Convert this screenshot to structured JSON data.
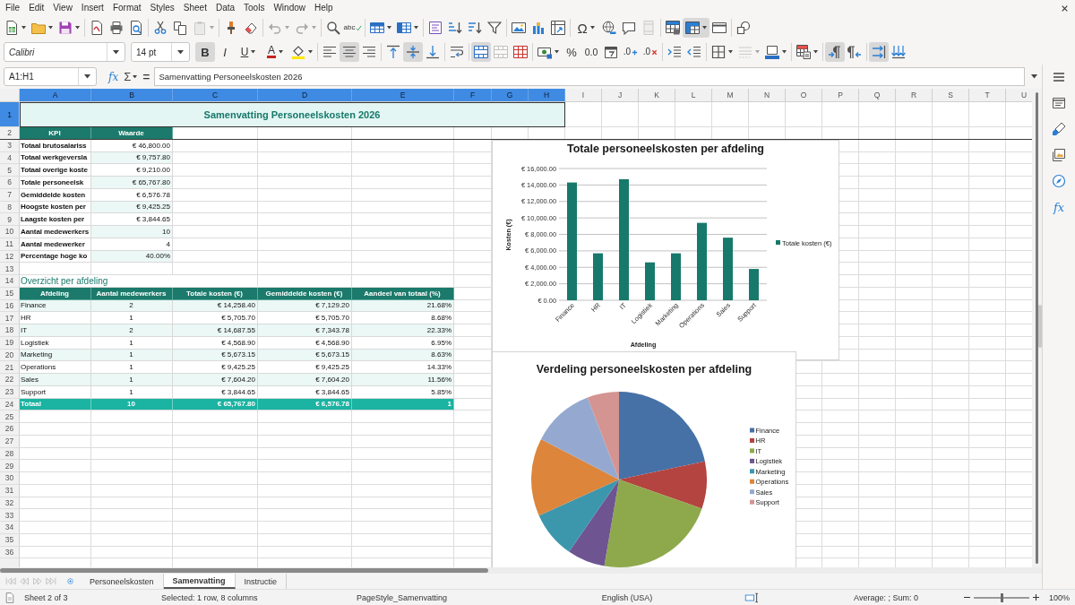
{
  "menu_bar": {
    "items": [
      "File",
      "Edit",
      "View",
      "Insert",
      "Format",
      "Styles",
      "Sheet",
      "Data",
      "Tools",
      "Window",
      "Help"
    ]
  },
  "standard_toolbar": {
    "groups": [
      [
        {
          "kind": "new",
          "on": false,
          "disabled": false,
          "dropdown": true
        },
        {
          "kind": "open",
          "on": false,
          "disabled": false,
          "dropdown": true
        },
        {
          "kind": "save",
          "on": false,
          "disabled": false,
          "dropdown": true
        }
      ],
      [
        {
          "kind": "pdf",
          "on": false,
          "disabled": false,
          "dropdown": false
        },
        {
          "kind": "print",
          "on": false,
          "disabled": false,
          "dropdown": false
        },
        {
          "kind": "preview",
          "on": false,
          "disabled": false,
          "dropdown": false
        }
      ],
      [
        {
          "kind": "cut",
          "on": false,
          "disabled": false,
          "dropdown": false
        },
        {
          "kind": "copy",
          "on": false,
          "disabled": false,
          "dropdown": false
        },
        {
          "kind": "paste",
          "on": false,
          "disabled": true,
          "dropdown": true
        }
      ],
      [
        {
          "kind": "clone",
          "on": false,
          "disabled": false,
          "dropdown": false
        },
        {
          "kind": "clear",
          "on": false,
          "disabled": false,
          "dropdown": false
        }
      ],
      [
        {
          "kind": "undo",
          "on": false,
          "disabled": true,
          "dropdown": true
        },
        {
          "kind": "redo",
          "on": false,
          "disabled": true,
          "dropdown": true
        }
      ],
      [
        {
          "kind": "find",
          "on": false,
          "disabled": false,
          "dropdown": false
        },
        {
          "kind": "spell",
          "label": "abc",
          "on": false,
          "disabled": false,
          "dropdown": false
        }
      ],
      [
        {
          "kind": "row",
          "on": false,
          "disabled": false,
          "dropdown": true
        },
        {
          "kind": "column",
          "on": false,
          "disabled": false,
          "dropdown": true
        }
      ],
      [
        {
          "kind": "sort",
          "on": false,
          "disabled": false,
          "dropdown": false
        },
        {
          "kind": "asc",
          "on": false,
          "disabled": false,
          "dropdown": false
        },
        {
          "kind": "desc",
          "on": false,
          "disabled": false,
          "dropdown": false
        },
        {
          "kind": "filter",
          "on": false,
          "disabled": false,
          "dropdown": false
        }
      ],
      [
        {
          "kind": "image",
          "on": false,
          "disabled": false,
          "dropdown": false
        },
        {
          "kind": "chart",
          "on": false,
          "disabled": false,
          "dropdown": false
        },
        {
          "kind": "pivot",
          "on": false,
          "disabled": false,
          "dropdown": false
        }
      ],
      [
        {
          "kind": "special",
          "label": "Ω",
          "on": false,
          "disabled": false,
          "dropdown": true
        },
        {
          "kind": "link",
          "on": false,
          "disabled": false,
          "dropdown": false
        },
        {
          "kind": "comment",
          "on": false,
          "disabled": false,
          "dropdown": false
        },
        {
          "kind": "headfoot",
          "on": false,
          "disabled": true,
          "dropdown": false
        }
      ],
      [
        {
          "kind": "printarea",
          "on": false,
          "disabled": false,
          "dropdown": false
        },
        {
          "kind": "freeze",
          "on": true,
          "disabled": false,
          "dropdown": true
        },
        {
          "kind": "split",
          "on": false,
          "disabled": false,
          "dropdown": false
        }
      ],
      [
        {
          "kind": "draw",
          "on": false,
          "disabled": false,
          "dropdown": false
        }
      ]
    ]
  },
  "formatting_toolbar": {
    "font_name": "Calibri",
    "font_size": "14 pt",
    "groups": [
      [
        {
          "kind": "bold",
          "label": "B",
          "on": true,
          "disabled": false,
          "dropdown": false
        },
        {
          "kind": "italic",
          "label": "I",
          "on": false,
          "disabled": false,
          "dropdown": false
        },
        {
          "kind": "underline",
          "label": "U",
          "on": false,
          "disabled": false,
          "dropdown": true
        },
        {
          "kind": "fontcolor",
          "label": "A",
          "on": false,
          "disabled": false,
          "dropdown": true
        },
        {
          "kind": "highlight",
          "on": false,
          "disabled": false,
          "dropdown": true
        }
      ],
      [
        {
          "kind": "alignleft",
          "on": false,
          "disabled": false,
          "dropdown": false
        },
        {
          "kind": "aligncenter",
          "on": true,
          "disabled": false,
          "dropdown": false
        },
        {
          "kind": "alignright",
          "on": false,
          "disabled": false,
          "dropdown": false
        }
      ],
      [
        {
          "kind": "top",
          "on": false,
          "disabled": false,
          "dropdown": false
        },
        {
          "kind": "middle",
          "on": true,
          "disabled": false,
          "dropdown": false
        },
        {
          "kind": "bottom",
          "on": false,
          "disabled": false,
          "dropdown": false
        }
      ],
      [
        {
          "kind": "wrap",
          "on": false,
          "disabled": false,
          "dropdown": false
        }
      ],
      [
        {
          "kind": "mergecenter",
          "on": true,
          "disabled": false,
          "dropdown": false
        },
        {
          "kind": "merge",
          "on": false,
          "disabled": true,
          "dropdown": false
        },
        {
          "kind": "unmerge",
          "on": false,
          "disabled": false,
          "dropdown": false
        }
      ],
      [
        {
          "kind": "currency",
          "on": false,
          "disabled": false,
          "dropdown": true
        },
        {
          "kind": "percent",
          "label": "%",
          "on": false,
          "disabled": false,
          "dropdown": false
        },
        {
          "kind": "number",
          "label": "0.0",
          "on": false,
          "disabled": false,
          "dropdown": false
        },
        {
          "kind": "date",
          "on": false,
          "disabled": false,
          "dropdown": false
        },
        {
          "kind": "adddec",
          "label": ".0",
          "on": false,
          "disabled": false,
          "dropdown": false
        },
        {
          "kind": "deldec",
          "label": ".0",
          "on": false,
          "disabled": false,
          "dropdown": false
        }
      ],
      [
        {
          "kind": "indent",
          "on": false,
          "disabled": false,
          "dropdown": false
        },
        {
          "kind": "outdent",
          "on": false,
          "disabled": false,
          "dropdown": false
        }
      ],
      [
        {
          "kind": "borders",
          "on": false,
          "disabled": false,
          "dropdown": true
        },
        {
          "kind": "borderstyle",
          "on": false,
          "disabled": true,
          "dropdown": true
        },
        {
          "kind": "bordercolor",
          "on": false,
          "disabled": false,
          "dropdown": true
        }
      ],
      [
        {
          "kind": "conditional",
          "on": false,
          "disabled": false,
          "dropdown": true
        }
      ],
      [
        {
          "kind": "ltr",
          "on": true,
          "disabled": false,
          "dropdown": false
        },
        {
          "kind": "rtl",
          "on": false,
          "disabled": false,
          "dropdown": false
        }
      ],
      [
        {
          "kind": "texth",
          "on": true,
          "disabled": false,
          "dropdown": false
        },
        {
          "kind": "textv",
          "on": false,
          "disabled": false,
          "dropdown": false
        }
      ]
    ]
  },
  "formula_bar": {
    "name_box": "A1:H1",
    "function_wizard": "fx",
    "sum": "Σ",
    "equals": "=",
    "content": "Samenvatting Personeelskosten 2026"
  },
  "sidebar": {
    "buttons": [
      {
        "kind": "menu"
      },
      {
        "kind": "properties"
      },
      {
        "kind": "styles"
      },
      {
        "kind": "gallery"
      },
      {
        "kind": "navigator"
      },
      {
        "kind": "functions",
        "label": "fx"
      }
    ]
  },
  "sheet": {
    "columns": [
      {
        "label": "A",
        "selected": true
      },
      {
        "label": "B",
        "selected": true
      },
      {
        "label": "C",
        "selected": true
      },
      {
        "label": "D",
        "selected": true
      },
      {
        "label": "E",
        "selected": true
      },
      {
        "label": "F",
        "selected": true
      },
      {
        "label": "G",
        "selected": true
      },
      {
        "label": "H",
        "selected": true
      },
      {
        "label": "I",
        "selected": false
      },
      {
        "label": "J",
        "selected": false
      },
      {
        "label": "K",
        "selected": false
      },
      {
        "label": "L",
        "selected": false
      },
      {
        "label": "M",
        "selected": false
      },
      {
        "label": "N",
        "selected": false
      },
      {
        "label": "O",
        "selected": false
      },
      {
        "label": "P",
        "selected": false
      },
      {
        "label": "Q",
        "selected": false
      },
      {
        "label": "R",
        "selected": false
      },
      {
        "label": "S",
        "selected": false
      },
      {
        "label": "T",
        "selected": false
      },
      {
        "label": "U",
        "selected": false
      }
    ],
    "row_numbers": [
      {
        "label": "1",
        "selected": true
      },
      {
        "label": "2",
        "selected": false
      },
      {
        "label": "3",
        "selected": false
      },
      {
        "label": "4",
        "selected": false
      },
      {
        "label": "5",
        "selected": false
      },
      {
        "label": "6",
        "selected": false
      },
      {
        "label": "7",
        "selected": false
      },
      {
        "label": "8",
        "selected": false
      },
      {
        "label": "9",
        "selected": false
      },
      {
        "label": "10",
        "selected": false
      },
      {
        "label": "11",
        "selected": false
      },
      {
        "label": "12",
        "selected": false
      },
      {
        "label": "13",
        "selected": false
      },
      {
        "label": "14",
        "selected": false
      },
      {
        "label": "15",
        "selected": false
      },
      {
        "label": "16",
        "selected": false
      },
      {
        "label": "17",
        "selected": false
      },
      {
        "label": "18",
        "selected": false
      },
      {
        "label": "19",
        "selected": false
      },
      {
        "label": "20",
        "selected": false
      },
      {
        "label": "21",
        "selected": false
      },
      {
        "label": "22",
        "selected": false
      },
      {
        "label": "23",
        "selected": false
      },
      {
        "label": "24",
        "selected": false
      },
      {
        "label": "25",
        "selected": false
      },
      {
        "label": "26",
        "selected": false
      },
      {
        "label": "27",
        "selected": false
      },
      {
        "label": "28",
        "selected": false
      },
      {
        "label": "29",
        "selected": false
      },
      {
        "label": "30",
        "selected": false
      },
      {
        "label": "31",
        "selected": false
      },
      {
        "label": "32",
        "selected": false
      },
      {
        "label": "33",
        "selected": false
      },
      {
        "label": "34",
        "selected": false
      },
      {
        "label": "35",
        "selected": false
      },
      {
        "label": "36",
        "selected": false
      }
    ],
    "title": {
      "text": "Samenvatting Personeelskosten 2026",
      "selected": true
    },
    "kpi_table": {
      "headers": [
        "KPI",
        "Waarde"
      ],
      "rows": [
        {
          "label": "Totaal brutosalariss",
          "value": "€ 46,800.00"
        },
        {
          "label": "Totaal werkgeversla",
          "value": "€ 9,757.80"
        },
        {
          "label": "Totaal overige koste",
          "value": "€ 9,210.00"
        },
        {
          "label": "Totale personeelsk",
          "value": "€ 65,767.80"
        },
        {
          "label": "Gemiddelde kosten",
          "value": "€ 6,576.78"
        },
        {
          "label": "Hoogste kosten per",
          "value": "€ 9,425.25"
        },
        {
          "label": "Laagste kosten per",
          "value": "€ 3,844.65"
        },
        {
          "label": "Aantal medewerkers",
          "value": "10"
        },
        {
          "label": "Aantal medewerker",
          "value": "4"
        },
        {
          "label": "Percentage hoge ko",
          "value": "40.00%"
        }
      ]
    },
    "section_heading": "Overzicht per afdeling",
    "department_table": {
      "headers": [
        "Afdeling",
        "Aantal medewerkers",
        "Totale kosten (€)",
        "Gemiddelde kosten (€)",
        "Aandeel van totaal (%)"
      ],
      "rows": [
        [
          "Finance",
          "2",
          "€ 14,258.40",
          "€ 7,129.20",
          "21.68%"
        ],
        [
          "HR",
          "1",
          "€ 5,705.70",
          "€ 5,705.70",
          "8.68%"
        ],
        [
          "IT",
          "2",
          "€ 14,687.55",
          "€ 7,343.78",
          "22.33%"
        ],
        [
          "Logistiek",
          "1",
          "€ 4,568.90",
          "€ 4,568.90",
          "6.95%"
        ],
        [
          "Marketing",
          "1",
          "€ 5,673.15",
          "€ 5,673.15",
          "8.63%"
        ],
        [
          "Operations",
          "1",
          "€ 9,425.25",
          "€ 9,425.25",
          "14.33%"
        ],
        [
          "Sales",
          "1",
          "€ 7,604.20",
          "€ 7,604.20",
          "11.56%"
        ],
        [
          "Support",
          "1",
          "€ 3,844.65",
          "€ 3,844.65",
          "5.85%"
        ]
      ],
      "total": [
        "Totaal",
        "10",
        "€ 65,767.80",
        "€ 6,576.78",
        "1"
      ]
    },
    "charts": [
      {
        "chart_data": {
          "type": "bar",
          "title": "Totale personeelskosten per afdeling",
          "xlabel": "Afdeling",
          "ylabel": "Kosten (€)",
          "categories": [
            "Finance",
            "HR",
            "IT",
            "Logistiek",
            "Marketing",
            "Operations",
            "Sales",
            "Support"
          ],
          "series": [
            {
              "name": "Totale kosten (€)",
              "color": "#17796b",
              "values": [
                14300,
                5700,
                14700,
                4600,
                5700,
                9400,
                7600,
                3800
              ]
            }
          ],
          "ylim": [
            0,
            16000
          ],
          "yticks": [
            {
              "value": 0,
              "label": "€ 0.00"
            },
            {
              "value": 2000,
              "label": "€ 2,000.00"
            },
            {
              "value": 4000,
              "label": "€ 4,000.00"
            },
            {
              "value": 6000,
              "label": "€ 6,000.00"
            },
            {
              "value": 8000,
              "label": "€ 8,000.00"
            },
            {
              "value": 10000,
              "label": "€ 10,000.00"
            },
            {
              "value": 12000,
              "label": "€ 12,000.00"
            },
            {
              "value": 14000,
              "label": "€ 14,000.00"
            },
            {
              "value": 16000,
              "label": "€ 16,000.00"
            }
          ],
          "grid": true,
          "legend": true
        }
      },
      {
        "chart_data": {
          "type": "pie",
          "title": "Verdeling personeelskosten per afdeling",
          "categories": [
            "Finance",
            "HR",
            "IT",
            "Logistiek",
            "Marketing",
            "Operations",
            "Sales",
            "Support"
          ],
          "series": [
            {
              "values": [
                21.68,
                8.68,
                22.33,
                6.95,
                8.63,
                14.33,
                11.56,
                5.84
              ]
            }
          ],
          "colors": [
            "#4671a6",
            "#b3443f",
            "#8ea94c",
            "#6e5490",
            "#3c97ad",
            "#dc853b",
            "#95a9d0",
            "#d49492"
          ],
          "legend": true
        }
      }
    ]
  },
  "sheet_tabs": {
    "navigation": [
      {
        "kind": "first",
        "disabled": true
      },
      {
        "kind": "previous",
        "disabled": true
      },
      {
        "kind": "next",
        "disabled": true
      },
      {
        "kind": "last",
        "disabled": true
      }
    ],
    "tabs": [
      {
        "label": "Personeelskosten",
        "selected": false
      },
      {
        "label": "Samenvatting",
        "selected": true
      },
      {
        "label": "Instructie",
        "selected": false
      }
    ]
  },
  "status_bar": {
    "sheet": "Sheet 2 of 3",
    "selection": "Selected: 1 row, 8 columns",
    "page_style": "PageStyle_Samenvatting",
    "language": "English (USA)",
    "summary": "Average: ; Sum: 0",
    "zoom": {
      "level": 0.5,
      "value": "100%"
    }
  }
}
